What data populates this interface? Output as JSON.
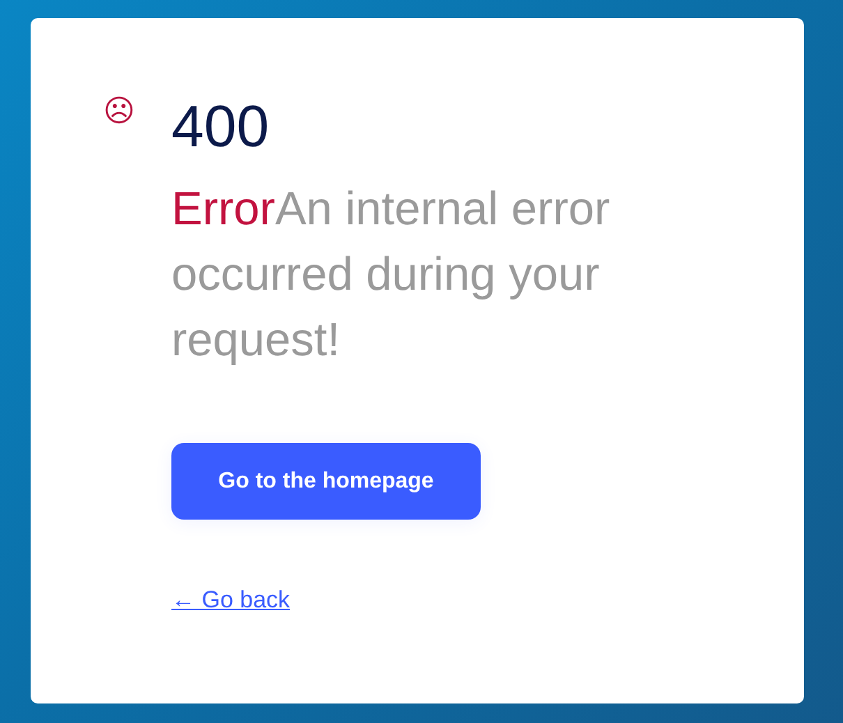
{
  "icon": "☹",
  "code": "400",
  "error_label": "Error",
  "message": "An internal error occurred during your request!",
  "primary_button": "Go to the homepage",
  "back_link": "← Go back"
}
